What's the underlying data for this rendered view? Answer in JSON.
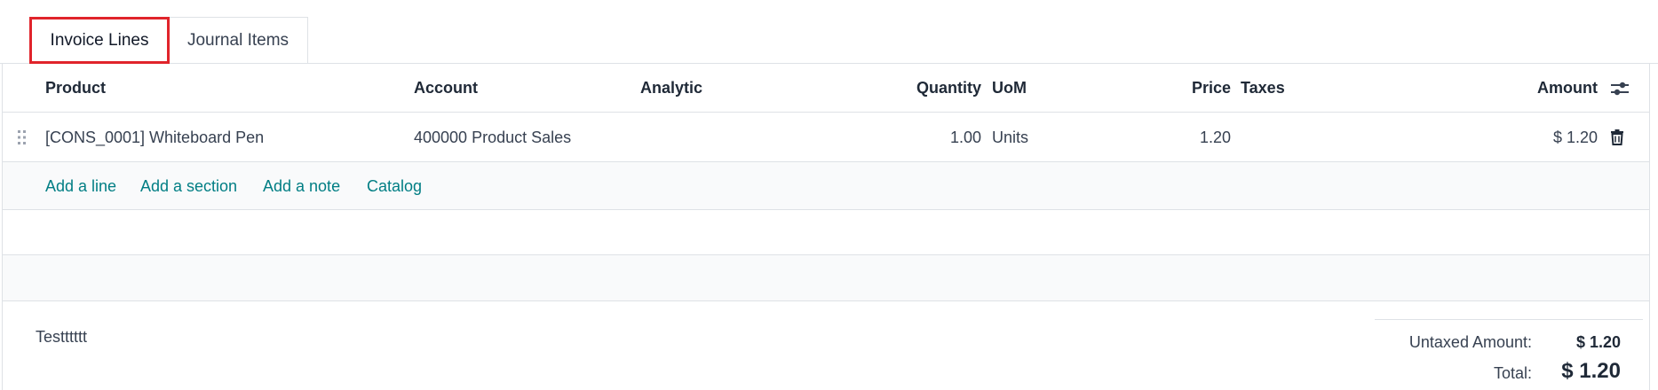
{
  "tabs": {
    "invoice_lines": "Invoice Lines",
    "journal_items": "Journal Items"
  },
  "table": {
    "headers": {
      "product": "Product",
      "account": "Account",
      "analytic": "Analytic",
      "quantity": "Quantity",
      "uom": "UoM",
      "price": "Price",
      "taxes": "Taxes",
      "amount": "Amount"
    },
    "rows": [
      {
        "product": "[CONS_0001] Whiteboard Pen",
        "account": "400000 Product Sales",
        "analytic": "",
        "quantity": "1.00",
        "uom": "Units",
        "price": "1.20",
        "taxes": "",
        "amount": "$ 1.20"
      }
    ],
    "actions": {
      "add_line": "Add a line",
      "add_section": "Add a section",
      "add_note": "Add a note",
      "catalog": "Catalog"
    }
  },
  "footer": {
    "note": "Testttttt",
    "untaxed_label": "Untaxed Amount:",
    "untaxed_value": "$ 1.20",
    "total_label": "Total:",
    "total_value": "$ 1.20"
  },
  "colors": {
    "link": "#017e84",
    "active_tab_border": "#e0242b",
    "border": "#dee2e6"
  },
  "icons": {
    "drag": "drag-handle-icon",
    "trash": "trash-icon",
    "settings": "column-settings-icon"
  }
}
